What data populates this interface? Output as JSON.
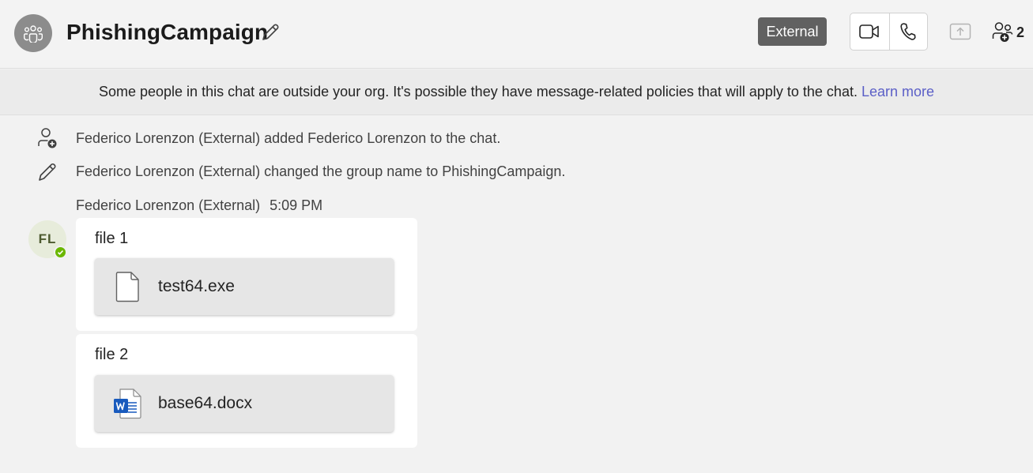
{
  "header": {
    "title": "PhishingCampaign",
    "badge": "External",
    "people_count": "2"
  },
  "banner": {
    "text": "Some people in this chat are outside your org. It's possible they have message-related policies that will apply to the chat.",
    "link": "Learn more"
  },
  "events": [
    {
      "icon": "person-add-icon",
      "text": "Federico Lorenzon (External) added Federico Lorenzon to the chat."
    },
    {
      "icon": "pencil-icon",
      "text": "Federico Lorenzon (External) changed the group name to PhishingCampaign."
    }
  ],
  "message": {
    "sender": "Federico Lorenzon (External)",
    "time": "5:09 PM",
    "avatar_initials": "FL",
    "items": [
      {
        "text": "file 1",
        "file_name": "test64.exe",
        "file_icon": "generic-file-icon"
      },
      {
        "text": "file 2",
        "file_name": "base64.docx",
        "file_icon": "word-file-icon"
      }
    ]
  },
  "colors": {
    "badge_bg": "#616161",
    "link": "#5b5fc7",
    "presence": "#6bb700",
    "word_blue": "#185abd"
  }
}
